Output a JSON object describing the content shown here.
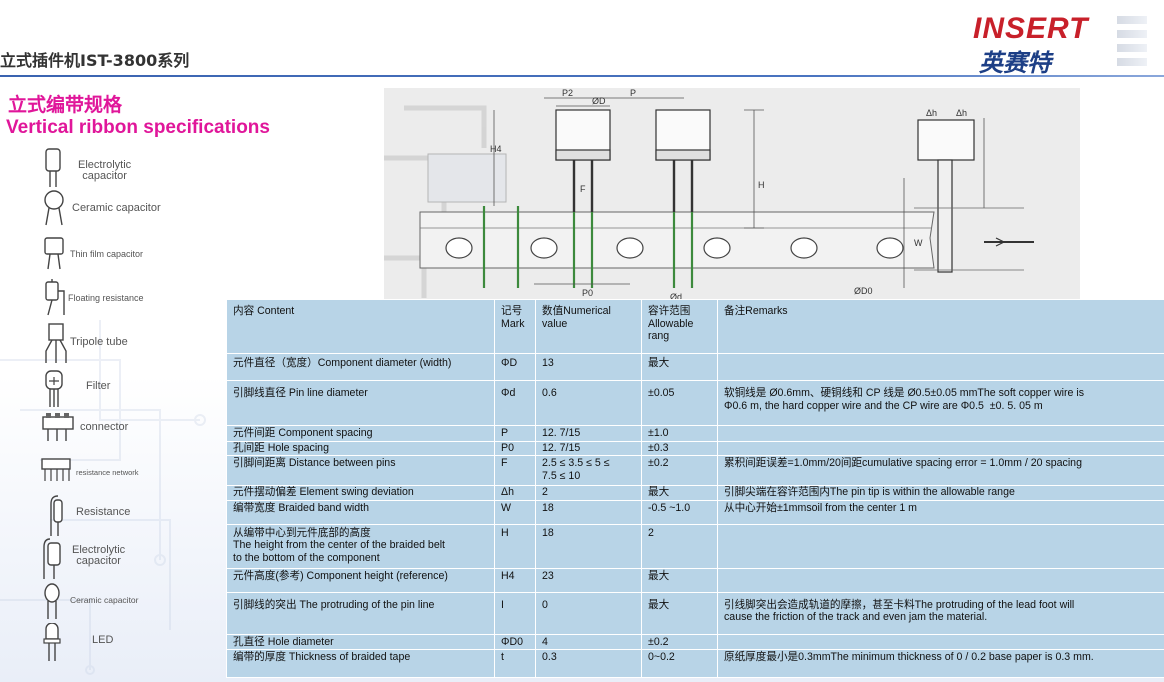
{
  "header": {
    "title": "立式插件机IST-3800系列",
    "logo_en": "INSERT",
    "logo_cn": "英赛特"
  },
  "subtitle": {
    "cn": "立式编带规格",
    "en": "Vertical ribbon specifications"
  },
  "components": [
    {
      "label": "Electrolytic\ncapacitor",
      "icon": "electrolytic-capacitor-icon"
    },
    {
      "label": "Ceramic capacitor",
      "icon": "ceramic-capacitor-icon"
    },
    {
      "label": "Thin film capacitor",
      "icon": "thin-film-capacitor-icon"
    },
    {
      "label": "Floating resistance",
      "icon": "floating-resistance-icon"
    },
    {
      "label": "Tripole tube",
      "icon": "tripole-tube-icon"
    },
    {
      "label": "Filter",
      "icon": "filter-icon"
    },
    {
      "label": "connector",
      "icon": "connector-icon"
    },
    {
      "label": "resistance network",
      "icon": "resistance-network-icon"
    },
    {
      "label": "Resistance",
      "icon": "resistance-icon"
    },
    {
      "label": "Electrolytic\ncapacitor",
      "icon": "electrolytic-capacitor-icon"
    },
    {
      "label": "Ceramic capacitor",
      "icon": "ceramic-capacitor-icon"
    },
    {
      "label": "LED",
      "icon": "led-icon"
    }
  ],
  "diagram": {
    "labels": [
      "P2",
      "ØD",
      "P",
      "H",
      "H4",
      "F",
      "Δh",
      "Δh",
      "W",
      "P0",
      "Ød",
      "ØD0"
    ]
  },
  "table": {
    "headers": [
      "内容 Content",
      "记号\nMark",
      "数值Numerical\nvalue",
      "容许范围\nAllowable\nrang",
      "备注Remarks"
    ],
    "rows": [
      [
        "元件直径（宽度）Component diameter (width)",
        "ΦD",
        "13",
        "最大",
        ""
      ],
      [
        "引脚线直径 Pin line diameter",
        "Φd",
        "0.6",
        "±0.05",
        "软铜线是 Ø0.6mm、硬铜线和 CP 线是 Ø0.5±0.05 mmThe soft copper wire is\nΦ0.6 m, the hard copper wire and the CP wire are Φ0.5  ±0. 5. 05 m"
      ],
      [
        "元件间距 Component spacing",
        "P",
        "12. 7/15",
        "±1.0",
        ""
      ],
      [
        "孔间距 Hole spacing",
        "P0",
        "12. 7/15",
        "±0.3",
        ""
      ],
      [
        "引脚间距离 Distance between pins",
        "F",
        "2.5 ≤ 3.5 ≤ 5 ≤\n7.5 ≤ 10",
        "±0.2",
        "累积间距误差=1.0mm/20间距cumulative spacing error = 1.0mm / 20 spacing"
      ],
      [
        "元件摆动偏差 Element swing deviation",
        "Δh",
        "2",
        "最大",
        "引脚尖端在容许范围内The pin tip is within the allowable range"
      ],
      [
        "编带宽度 Braided band width",
        "W",
        "18",
        "-0.5 ~1.0",
        "从中心开始±1mmsoil from the center 1 m"
      ],
      [
        "从编带中心到元件底部的高度\nThe height from the center of the braided belt\nto the bottom of the component",
        "H",
        "18",
        "2",
        ""
      ],
      [
        "元件高度(参考) Component height (reference)",
        "H4",
        "23",
        "最大",
        ""
      ],
      [
        "引脚线的突出  The protruding of the pin line",
        "I",
        "0",
        "最大",
        "引线脚突出会造成轨道的摩擦，甚至卡料The protruding of the lead foot will\ncause the friction of the track and even jam the material."
      ],
      [
        "孔直径 Hole diameter",
        "ΦD0",
        "4",
        "±0.2",
        ""
      ],
      [
        "编带的厚度  Thickness of braided tape",
        "t",
        "0.3",
        "0~0.2",
        "原纸厚度最小是0.3mmThe minimum thickness of 0 / 0.2 base paper is 0.3 mm."
      ]
    ]
  },
  "colors": {
    "accent_magenta": "#e0169a",
    "header_blue": "#3a63b0",
    "table_bg": "#b8d4e7",
    "logo_red": "#c8202a",
    "logo_blue": "#1d3f86"
  }
}
